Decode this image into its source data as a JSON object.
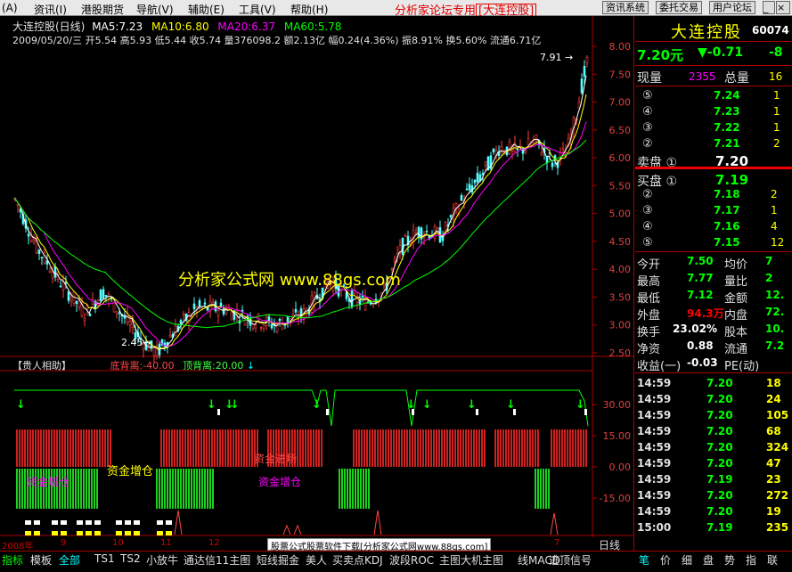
{
  "menu": [
    "(A)",
    "资讯(I)",
    "港股期货",
    "导航(V)",
    "辅助(E)",
    "工具(V)",
    "帮助(H)"
  ],
  "banner": {
    "text": "分析家论坛专用",
    "boxed": "[大连控股]"
  },
  "top_buttons": [
    "资讯系统",
    "委托交易",
    "用户论坛"
  ],
  "chart": {
    "title": "大连控股(日线)",
    "ma5": "MA5:7.23",
    "ma10": "MA10:6.80",
    "ma20": "MA20:6.37",
    "ma60": "MA60:5.78",
    "info_line": "2009/05/20/三 开5.54 高5.93 低5.44 收5.74 量376098.2 额2.13亿 幅0.24(4.36%) 振8.91% 换5.60% 流通6.71亿",
    "high_label": "7.91",
    "low_label": "2.45",
    "watermark": "分析家公式网 www.88gs.com",
    "price_ticks": [
      "8.00",
      "7.50",
      "7.00",
      "6.50",
      "6.00",
      "5.50",
      "5.00",
      "4.50",
      "4.00",
      "3.50",
      "3.00",
      "2.50"
    ],
    "indicator_title": "【贵人相助】",
    "indicator_bottom": "底背离:-40.00",
    "indicator_top": "顶背离:20.00",
    "indicator_ticks": [
      "30.00",
      "15.00",
      "0.00",
      "-15.00"
    ],
    "indicator_texts": [
      "资金增仓",
      "资金增仓",
      "资金增仓",
      "资金进场"
    ],
    "footer_text": "股票公式股票软件下载[分析家公式网www.88gs.com]",
    "date_labels": [
      "2008年",
      "9",
      "10",
      "11",
      "12",
      "7"
    ],
    "period": "日线"
  },
  "chart_data": {
    "type": "candlestick",
    "title": "大连控股(日线)",
    "ylim": [
      2.3,
      8.2
    ],
    "ma": [
      {
        "name": "MA5",
        "value": 7.23,
        "color": "#ffffff"
      },
      {
        "name": "MA10",
        "value": 6.8,
        "color": "#ffff00"
      },
      {
        "name": "MA20",
        "value": 6.37,
        "color": "#ff00ff"
      },
      {
        "name": "MA60",
        "value": 5.78,
        "color": "#00ff00"
      }
    ],
    "annotations": [
      {
        "label": "7.91",
        "value": 7.91
      },
      {
        "label": "2.45",
        "value": 2.45
      }
    ],
    "last_day": {
      "date": "2009/05/20",
      "open": 5.54,
      "high": 5.93,
      "low": 5.44,
      "close": 5.74,
      "volume": 376098.2
    }
  },
  "quote": {
    "name": "大连控股",
    "code": "60074",
    "price": "7.20元",
    "change": "▼-0.71",
    "change2": "-8",
    "vol_label": "现量",
    "vol": "2355",
    "total_label": "总量",
    "total": "16",
    "sells": [
      {
        "lv": "⑤",
        "p": "7.24",
        "v": "1"
      },
      {
        "lv": "④",
        "p": "7.23",
        "v": "1"
      },
      {
        "lv": "③",
        "p": "7.22",
        "v": "1"
      },
      {
        "lv": "②",
        "p": "7.21",
        "v": "2"
      },
      {
        "lv": "卖盘 ①",
        "p": "7.20",
        "v": ""
      }
    ],
    "buys": [
      {
        "lv": "买盘 ①",
        "p": "7.19",
        "v": ""
      },
      {
        "lv": "②",
        "p": "7.18",
        "v": "2"
      },
      {
        "lv": "③",
        "p": "7.17",
        "v": "1"
      },
      {
        "lv": "④",
        "p": "7.16",
        "v": "4"
      },
      {
        "lv": "⑤",
        "p": "7.15",
        "v": "12"
      }
    ],
    "stats": [
      [
        "今开",
        "7.50",
        "均价",
        "7"
      ],
      [
        "最高",
        "7.77",
        "量比",
        "2"
      ],
      [
        "最低",
        "7.12",
        "金额",
        "12."
      ],
      [
        "外盘",
        "94.3万",
        "内盘",
        "72."
      ],
      [
        "换手",
        "23.02%",
        "股本",
        "10."
      ],
      [
        "净资",
        "0.88",
        "流通",
        "7.2"
      ],
      [
        "收益(一)",
        "-0.03",
        "PE(动)",
        ""
      ]
    ],
    "ticks": [
      [
        "14:59",
        "7.20",
        "18"
      ],
      [
        "14:59",
        "7.20",
        "24"
      ],
      [
        "14:59",
        "7.20",
        "105"
      ],
      [
        "14:59",
        "7.20",
        "68"
      ],
      [
        "14:59",
        "7.20",
        "324"
      ],
      [
        "14:59",
        "7.20",
        "47"
      ],
      [
        "14:59",
        "7.19",
        "23"
      ],
      [
        "14:59",
        "7.20",
        "272"
      ],
      [
        "14:59",
        "7.20",
        "19"
      ],
      [
        "15:00",
        "7.19",
        "235"
      ]
    ],
    "right_tabs": [
      "笔",
      "价",
      "细",
      "盘",
      "势",
      "指",
      "联"
    ]
  },
  "bottom_tabs": [
    "指标",
    "模板",
    "全部",
    "TS1",
    "TS2",
    "小放牛",
    "通达信11主图",
    "短线掘金",
    "美人",
    "买卖点KDJ",
    "波段ROC",
    "主图大机主图",
    "线MACD",
    "逃顶信号"
  ]
}
